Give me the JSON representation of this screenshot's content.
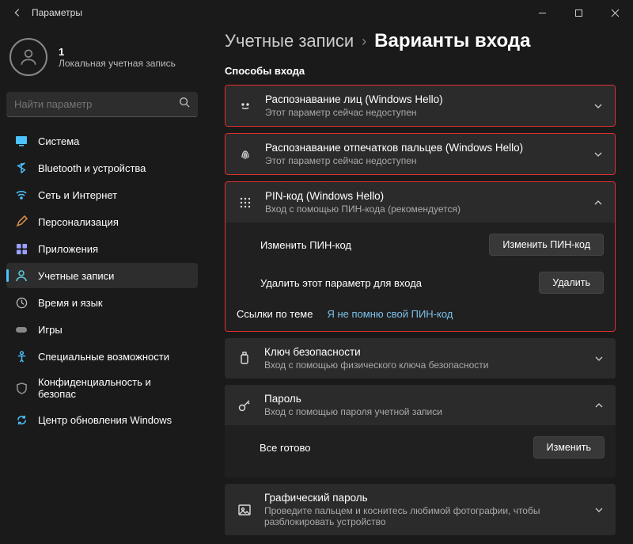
{
  "window": {
    "title": "Параметры"
  },
  "profile": {
    "name": "1",
    "type": "Локальная учетная запись"
  },
  "search": {
    "placeholder": "Найти параметр"
  },
  "sidebar": {
    "items": [
      {
        "label": "Система"
      },
      {
        "label": "Bluetooth и устройства"
      },
      {
        "label": "Сеть и Интернет"
      },
      {
        "label": "Персонализация"
      },
      {
        "label": "Приложения"
      },
      {
        "label": "Учетные записи"
      },
      {
        "label": "Время и язык"
      },
      {
        "label": "Игры"
      },
      {
        "label": "Специальные возможности"
      },
      {
        "label": "Конфиденциальность и безопас"
      },
      {
        "label": "Центр обновления Windows"
      }
    ]
  },
  "breadcrumb": {
    "parent": "Учетные записи",
    "current": "Варианты входа"
  },
  "section_title": "Способы входа",
  "options": {
    "face": {
      "title": "Распознавание лиц (Windows Hello)",
      "sub": "Этот параметр сейчас недоступен"
    },
    "finger": {
      "title": "Распознавание отпечатков пальцев (Windows Hello)",
      "sub": "Этот параметр сейчас недоступен"
    },
    "pin": {
      "title": "PIN-код (Windows Hello)",
      "sub": "Вход с помощью ПИН-кода (рекомендуется)",
      "change_label": "Изменить ПИН-код",
      "change_btn": "Изменить ПИН-код",
      "remove_label": "Удалить этот параметр для входа",
      "remove_btn": "Удалить",
      "related_heading": "Ссылки по теме",
      "forgot_link": "Я не помню свой ПИН-код"
    },
    "seckey": {
      "title": "Ключ безопасности",
      "sub": "Вход с помощью физического ключа безопасности"
    },
    "password": {
      "title": "Пароль",
      "sub": "Вход с помощью пароля учетной записи",
      "status": "Все готово",
      "change_btn": "Изменить"
    },
    "picture": {
      "title": "Графический пароль",
      "sub": "Проведите пальцем и коснитесь любимой фотографии, чтобы разблокировать устройство"
    }
  }
}
